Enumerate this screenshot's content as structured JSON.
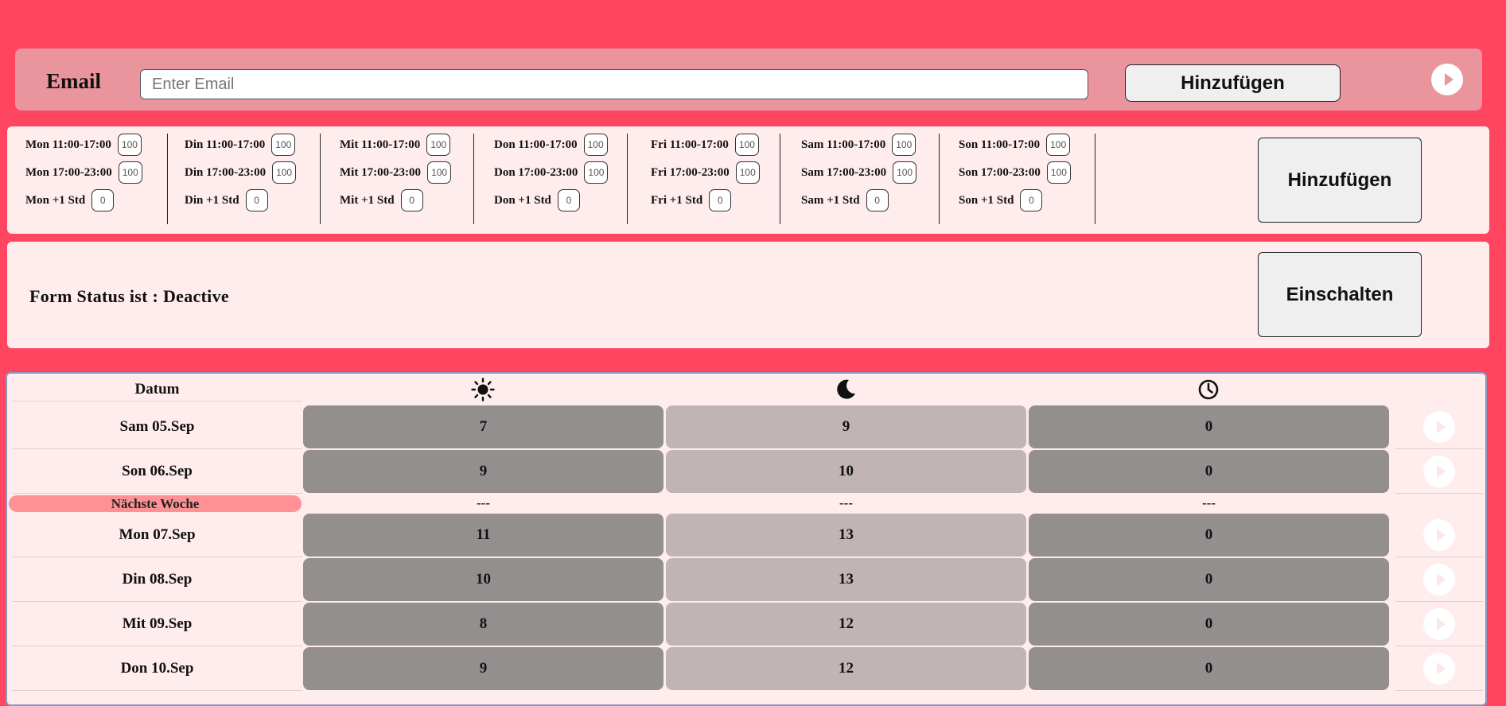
{
  "email": {
    "label": "Email",
    "placeholder": "Enter Email",
    "value": "",
    "add_button": "Hinzufügen"
  },
  "schedule": {
    "days": [
      {
        "slots": [
          {
            "label": "Mon 11:00-17:00",
            "value": "100"
          },
          {
            "label": "Mon 17:00-23:00",
            "value": "100"
          },
          {
            "label": "Mon +1 Std",
            "value": "0"
          }
        ]
      },
      {
        "slots": [
          {
            "label": "Din 11:00-17:00",
            "value": "100"
          },
          {
            "label": "Din 17:00-23:00",
            "value": "100"
          },
          {
            "label": "Din +1 Std",
            "value": "0"
          }
        ]
      },
      {
        "slots": [
          {
            "label": "Mit 11:00-17:00",
            "value": "100"
          },
          {
            "label": "Mit 17:00-23:00",
            "value": "100"
          },
          {
            "label": "Mit +1 Std",
            "value": "0"
          }
        ]
      },
      {
        "slots": [
          {
            "label": "Don 11:00-17:00",
            "value": "100"
          },
          {
            "label": "Don 17:00-23:00",
            "value": "100"
          },
          {
            "label": "Don +1 Std",
            "value": "0"
          }
        ]
      },
      {
        "slots": [
          {
            "label": "Fri 11:00-17:00",
            "value": "100"
          },
          {
            "label": "Fri 17:00-23:00",
            "value": "100"
          },
          {
            "label": "Fri +1 Std",
            "value": "0"
          }
        ]
      },
      {
        "slots": [
          {
            "label": "Sam 11:00-17:00",
            "value": "100"
          },
          {
            "label": "Sam 17:00-23:00",
            "value": "100"
          },
          {
            "label": "Sam +1 Std",
            "value": "0"
          }
        ]
      },
      {
        "slots": [
          {
            "label": "Son 11:00-17:00",
            "value": "100"
          },
          {
            "label": "Son 17:00-23:00",
            "value": "100"
          },
          {
            "label": "Son +1 Std",
            "value": "0"
          }
        ]
      }
    ],
    "add_button": "Hinzufügen"
  },
  "status": {
    "text": "Form Status ist : Deactive",
    "toggle_button": "Einschalten"
  },
  "table": {
    "header": {
      "date": "Datum",
      "icons": [
        "sun-icon",
        "moon-icon",
        "clock-icon"
      ]
    },
    "rows_before": [
      {
        "date": "Sam 05.Sep",
        "day": "7",
        "night": "9",
        "extra": "0"
      },
      {
        "date": "Son 06.Sep",
        "day": "9",
        "night": "10",
        "extra": "0"
      }
    ],
    "week_separator": {
      "label": "Nächste Woche",
      "dash": "---"
    },
    "rows_after": [
      {
        "date": "Mon 07.Sep",
        "day": "11",
        "night": "13",
        "extra": "0"
      },
      {
        "date": "Din 08.Sep",
        "day": "10",
        "night": "13",
        "extra": "0"
      },
      {
        "date": "Mit 09.Sep",
        "day": "8",
        "night": "12",
        "extra": "0"
      },
      {
        "date": "Don 10.Sep",
        "day": "9",
        "night": "12",
        "extra": "0"
      }
    ]
  },
  "colors": {
    "background": "#ff4560",
    "panel": "#ffeced",
    "email_bar": "#ea959e",
    "cell_dark": "#938f8f",
    "cell_light": "#c0b4b5",
    "week_label": "#ff9195"
  }
}
